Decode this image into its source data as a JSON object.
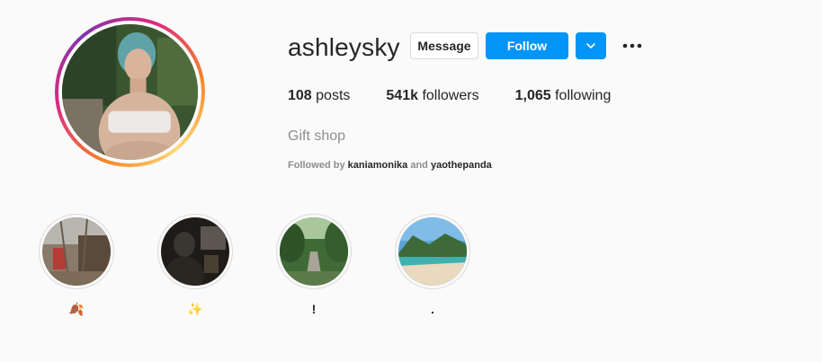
{
  "profile": {
    "username": "ashleysky",
    "full_name": "Gift shop",
    "avatar_icon": "profile-photo"
  },
  "actions": {
    "message_label": "Message",
    "follow_label": "Follow",
    "dropdown_icon": "chevron-down-icon",
    "more_icon": "more-options-icon"
  },
  "stats": {
    "posts_count": "108",
    "posts_label": "posts",
    "followers_count": "541k",
    "followers_label": "followers",
    "following_count": "1,065",
    "following_label": "following"
  },
  "followed_by": {
    "prefix": "Followed by",
    "user1": "kaniamonika",
    "conj": "and",
    "user2": "yaothepanda"
  },
  "highlights": [
    {
      "label": "🍂"
    },
    {
      "label": "✨"
    },
    {
      "label": "!"
    },
    {
      "label": "."
    }
  ],
  "colors": {
    "accent": "#0095f6",
    "muted": "#8e8e8e",
    "text": "#262626",
    "background": "#fafafa"
  }
}
